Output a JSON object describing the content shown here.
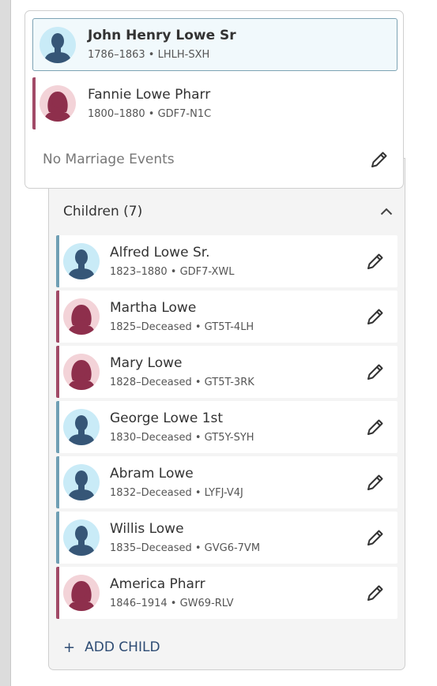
{
  "couple": {
    "husband": {
      "name": "John Henry Lowe Sr",
      "meta": "1786–1863 • LHLH-SXH",
      "icon": "male-avatar-icon"
    },
    "wife": {
      "name": "Fannie Lowe Pharr",
      "meta": "1800–1880 • GDF7-N1C",
      "icon": "female-avatar-icon"
    },
    "marriage_text": "No Marriage Events",
    "edit_icon": "pencil-icon"
  },
  "children": {
    "title": "Children (7)",
    "collapse_icon": "chevron-up-icon",
    "items": [
      {
        "name": "Alfred Lowe Sr.",
        "meta": "1823–1880 • GDF7-XWL",
        "gender": "male"
      },
      {
        "name": "Martha Lowe",
        "meta": "1825–Deceased • GT5T-4LH",
        "gender": "female"
      },
      {
        "name": "Mary Lowe",
        "meta": "1828–Deceased • GT5T-3RK",
        "gender": "female"
      },
      {
        "name": "George Lowe 1st",
        "meta": "1830–Deceased • GT5Y-SYH",
        "gender": "male"
      },
      {
        "name": "Abram Lowe",
        "meta": "1832–Deceased • LYFJ-V4J",
        "gender": "male"
      },
      {
        "name": "Willis Lowe",
        "meta": "1835–Deceased • GVG6-7VM",
        "gender": "male"
      },
      {
        "name": "America Pharr",
        "meta": "1846–1914 • GW69-RLV",
        "gender": "female"
      }
    ],
    "add_child": {
      "plus": "+",
      "label": "ADD CHILD"
    }
  },
  "colors": {
    "male_accent": "#6f9fb4",
    "female_accent": "#a14a67",
    "male_avatar_bg": "#c9ebf7",
    "male_avatar_fg": "#365677",
    "female_avatar_bg": "#f3d3d8",
    "female_avatar_fg": "#8e2f4c",
    "link": "#2d4b73"
  }
}
